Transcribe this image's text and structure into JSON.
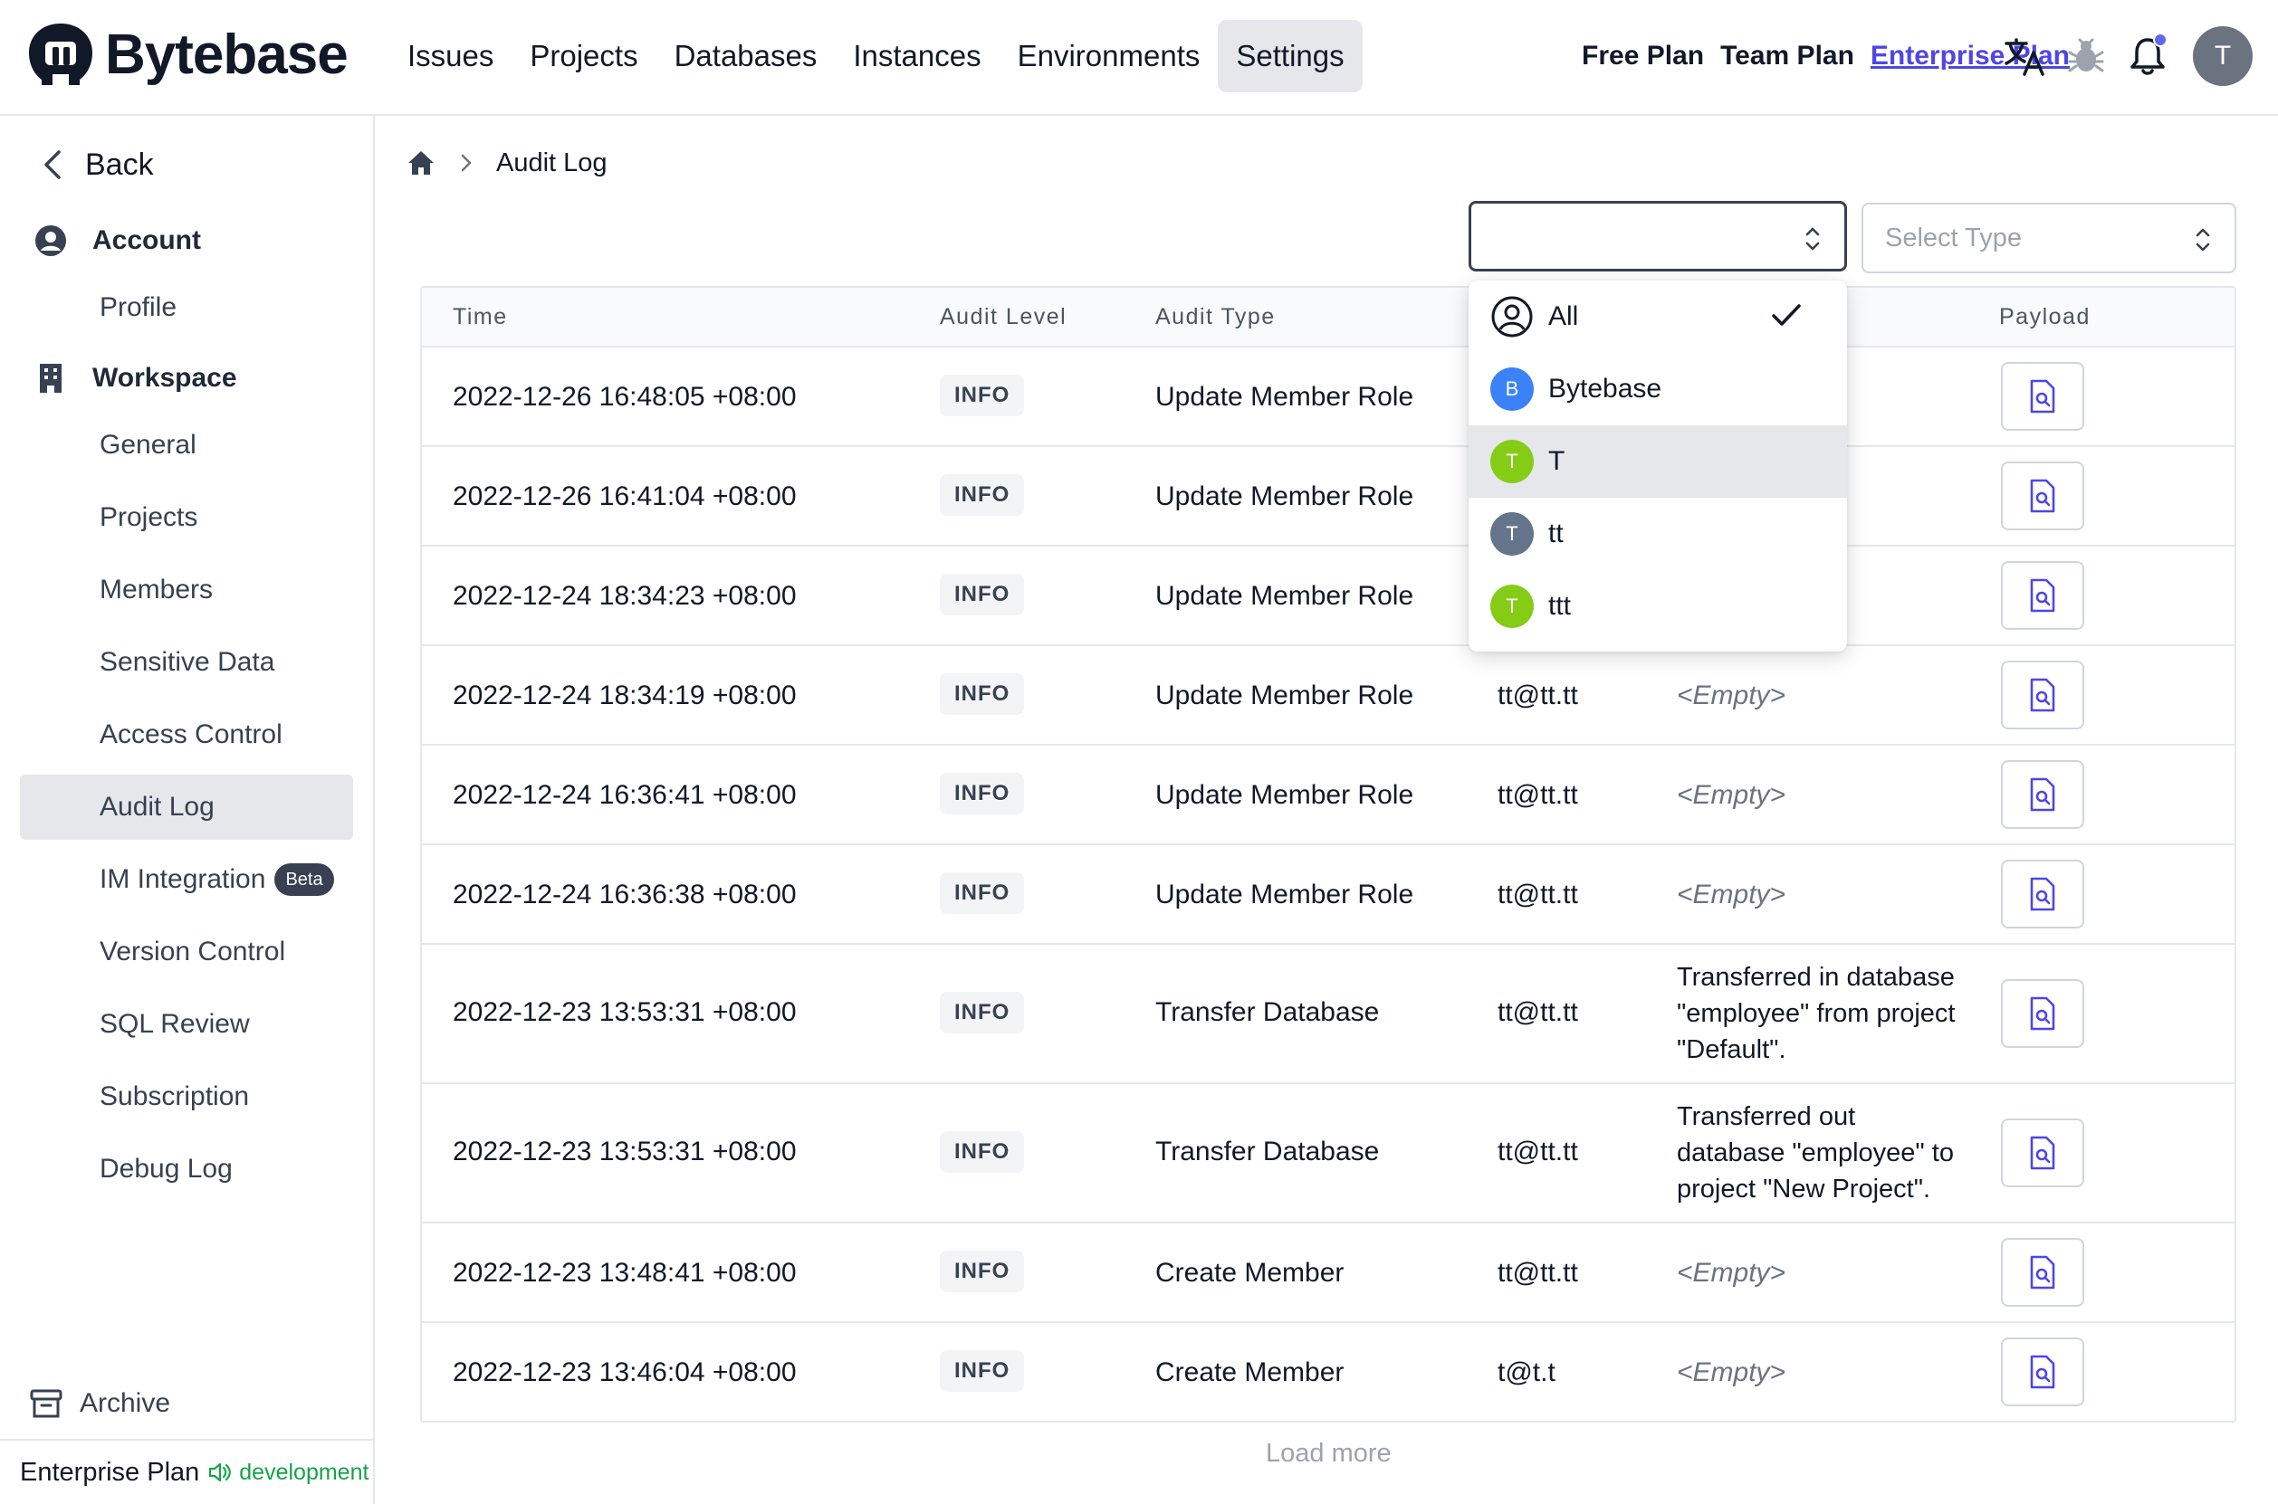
{
  "app": {
    "brand": "Bytebase"
  },
  "nav": {
    "items": [
      "Issues",
      "Projects",
      "Databases",
      "Instances",
      "Environments",
      "Settings"
    ],
    "active": "Settings"
  },
  "plans": {
    "free": "Free Plan",
    "team": "Team Plan",
    "enterprise": "Enterprise Plan"
  },
  "user": {
    "initial": "T"
  },
  "sidebar": {
    "back": "Back",
    "account": {
      "title": "Account",
      "items": [
        "Profile"
      ]
    },
    "workspace": {
      "title": "Workspace",
      "items": [
        "General",
        "Projects",
        "Members",
        "Sensitive Data",
        "Access Control",
        "Audit Log",
        "IM Integration",
        "Version Control",
        "SQL Review",
        "Subscription",
        "Debug Log"
      ],
      "active": "Audit Log",
      "beta_label": "Beta"
    },
    "archive": "Archive",
    "footer": {
      "plan": "Enterprise Plan",
      "env": "development"
    }
  },
  "breadcrumb": {
    "current": "Audit Log"
  },
  "filters": {
    "user_select_value": "",
    "type_placeholder": "Select Type"
  },
  "table": {
    "headers": {
      "time": "Time",
      "level": "Audit Level",
      "type": "Audit Type",
      "payload": "Payload"
    },
    "rows": [
      {
        "time": "2022-12-26 16:48:05 +08:00",
        "level": "INFO",
        "type": "Update Member Role",
        "creator": "",
        "comment": ""
      },
      {
        "time": "2022-12-26 16:41:04 +08:00",
        "level": "INFO",
        "type": "Update Member Role",
        "creator": "",
        "comment": ""
      },
      {
        "time": "2022-12-24 18:34:23 +08:00",
        "level": "INFO",
        "type": "Update Member Role",
        "creator": "",
        "comment": ""
      },
      {
        "time": "2022-12-24 18:34:19 +08:00",
        "level": "INFO",
        "type": "Update Member Role",
        "creator": "tt@tt.tt",
        "comment": "<Empty>"
      },
      {
        "time": "2022-12-24 16:36:41 +08:00",
        "level": "INFO",
        "type": "Update Member Role",
        "creator": "tt@tt.tt",
        "comment": "<Empty>"
      },
      {
        "time": "2022-12-24 16:36:38 +08:00",
        "level": "INFO",
        "type": "Update Member Role",
        "creator": "tt@tt.tt",
        "comment": "<Empty>"
      },
      {
        "time": "2022-12-23 13:53:31 +08:00",
        "level": "INFO",
        "type": "Transfer Database",
        "creator": "tt@tt.tt",
        "comment_lines": [
          "Transferred in database",
          "\"employee\" from project",
          "\"Default\"."
        ]
      },
      {
        "time": "2022-12-23 13:53:31 +08:00",
        "level": "INFO",
        "type": "Transfer Database",
        "creator": "tt@tt.tt",
        "comment_lines": [
          "Transferred out",
          "database \"employee\" to",
          "project \"New Project\"."
        ]
      },
      {
        "time": "2022-12-23 13:48:41 +08:00",
        "level": "INFO",
        "type": "Create Member",
        "creator": "tt@tt.tt",
        "comment": "<Empty>"
      },
      {
        "time": "2022-12-23 13:46:04 +08:00",
        "level": "INFO",
        "type": "Create Member",
        "creator": "t@t.t",
        "comment": "<Empty>"
      }
    ],
    "load_more": "Load more"
  },
  "user_dropdown": {
    "options": [
      {
        "label": "All",
        "avatar": "",
        "color": "",
        "selected": true
      },
      {
        "label": "Bytebase",
        "avatar": "B",
        "color": "#3b82f6"
      },
      {
        "label": "T",
        "avatar": "T",
        "color": "#84cc16",
        "hovered": true
      },
      {
        "label": "tt",
        "avatar": "T",
        "color": "#64748b"
      },
      {
        "label": "ttt",
        "avatar": "T",
        "color": "#84cc16"
      }
    ]
  },
  "colors": {
    "accent": "#4f46e5",
    "env_green": "#16a34a",
    "active_bg": "#e5e7eb"
  }
}
